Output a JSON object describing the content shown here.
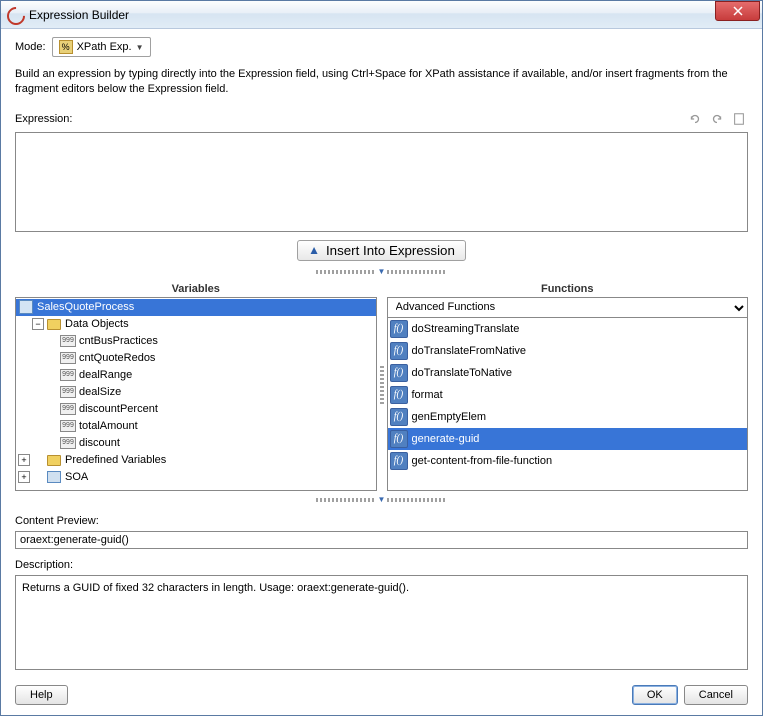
{
  "window": {
    "title": "Expression Builder"
  },
  "mode": {
    "label": "Mode:",
    "value": "XPath Exp."
  },
  "helpText": "Build an expression by typing directly into the Expression field, using Ctrl+Space for XPath assistance if available, and/or insert fragments from the fragment editors below the Expression field.",
  "expression": {
    "label": "Expression:",
    "value": ""
  },
  "insertBtn": "Insert Into Expression",
  "variables": {
    "header": "Variables",
    "rootName": "SalesQuoteProcess",
    "dataObjectsLabel": "Data Objects",
    "items": [
      "cntBusPractices",
      "cntQuoteRedos",
      "dealRange",
      "dealSize",
      "discountPercent",
      "totalAmount",
      "discount"
    ],
    "predefinedLabel": "Predefined Variables",
    "soaLabel": "SOA"
  },
  "functions": {
    "header": "Functions",
    "category": "Advanced Functions",
    "items": [
      {
        "name": "doStreamingTranslate",
        "selected": false
      },
      {
        "name": "doTranslateFromNative",
        "selected": false
      },
      {
        "name": "doTranslateToNative",
        "selected": false
      },
      {
        "name": "format",
        "selected": false
      },
      {
        "name": "genEmptyElem",
        "selected": false
      },
      {
        "name": "generate-guid",
        "selected": true
      },
      {
        "name": "get-content-from-file-function",
        "selected": false
      }
    ]
  },
  "preview": {
    "label": "Content Preview:",
    "value": "oraext:generate-guid()"
  },
  "description": {
    "label": "Description:",
    "value": "Returns a GUID of fixed 32 characters in length. Usage: oraext:generate-guid()."
  },
  "buttons": {
    "help": "Help",
    "ok": "OK",
    "cancel": "Cancel"
  }
}
